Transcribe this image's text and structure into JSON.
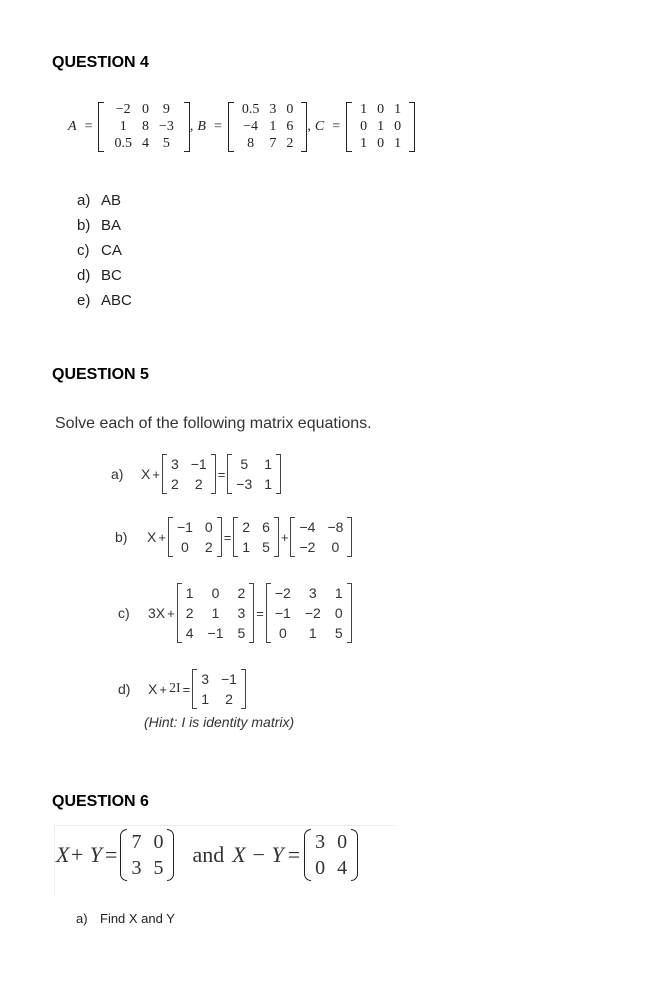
{
  "q4": {
    "title": "QUESTION 4",
    "matrices": {
      "A": {
        "label": "A",
        "rows": [
          [
            "−2",
            "0",
            "9"
          ],
          [
            "1",
            "8",
            "−3"
          ],
          [
            "0.5",
            "4",
            "5"
          ]
        ]
      },
      "B": {
        "label": "B",
        "rows": [
          [
            "0.5",
            "3",
            "0"
          ],
          [
            "−4",
            "1",
            "6"
          ],
          [
            "8",
            "7",
            "2"
          ]
        ]
      },
      "C": {
        "label": "C",
        "rows": [
          [
            "1",
            "0",
            "1"
          ],
          [
            "0",
            "1",
            "0"
          ],
          [
            "1",
            "0",
            "1"
          ]
        ]
      }
    },
    "equals": "=",
    "comma": ",",
    "items": [
      {
        "key": "a)",
        "text": "AB"
      },
      {
        "key": "b)",
        "text": "BA"
      },
      {
        "key": "c)",
        "text": "CA"
      },
      {
        "key": "d)",
        "text": "BC"
      },
      {
        "key": "e)",
        "text": "ABC"
      }
    ]
  },
  "q5": {
    "title": "QUESTION 5",
    "instruction": "Solve each of the following matrix equations.",
    "a": {
      "key": "a)",
      "lhs": "X",
      "plus": "+",
      "eq": "=",
      "m1": [
        [
          "3",
          "−1"
        ],
        [
          "2",
          "2"
        ]
      ],
      "m2": [
        [
          "5",
          "1"
        ],
        [
          "−3",
          "1"
        ]
      ]
    },
    "b": {
      "key": "b)",
      "lhs": "X",
      "plus": "+",
      "eq": "=",
      "plus2": "+",
      "m1": [
        [
          "−1",
          "0"
        ],
        [
          "0",
          "2"
        ]
      ],
      "m2": [
        [
          "2",
          "6"
        ],
        [
          "1",
          "5"
        ]
      ],
      "m3": [
        [
          "−4",
          "−8"
        ],
        [
          "−2",
          "0"
        ]
      ]
    },
    "c": {
      "key": "c)",
      "lhs": "3X",
      "plus": "+",
      "eq": "=",
      "m1": [
        [
          "1",
          "0",
          "2"
        ],
        [
          "2",
          "1",
          "3"
        ],
        [
          "4",
          "−1",
          "5"
        ]
      ],
      "m2": [
        [
          "−2",
          "3",
          "1"
        ],
        [
          "−1",
          "−2",
          "0"
        ],
        [
          "0",
          "1",
          "5"
        ]
      ]
    },
    "d": {
      "key": "d)",
      "lhs": "X",
      "plus": "+",
      "term": "2I",
      "eq": "=",
      "m1": [
        [
          "3",
          "−1"
        ],
        [
          "1",
          "2"
        ]
      ],
      "hint": "(Hint: I  is identity matrix)"
    }
  },
  "q6": {
    "title": "QUESTION 6",
    "eq1_lhs": "X+ Y",
    "eq": "=",
    "m1": [
      [
        "7",
        "0"
      ],
      [
        "3",
        "5"
      ]
    ],
    "and": "and",
    "eq2_lhs": "X − Y",
    "m2": [
      [
        "3",
        "0"
      ],
      [
        "0",
        "4"
      ]
    ],
    "items": [
      {
        "key": "a)",
        "text": "Find X and Y"
      }
    ]
  }
}
